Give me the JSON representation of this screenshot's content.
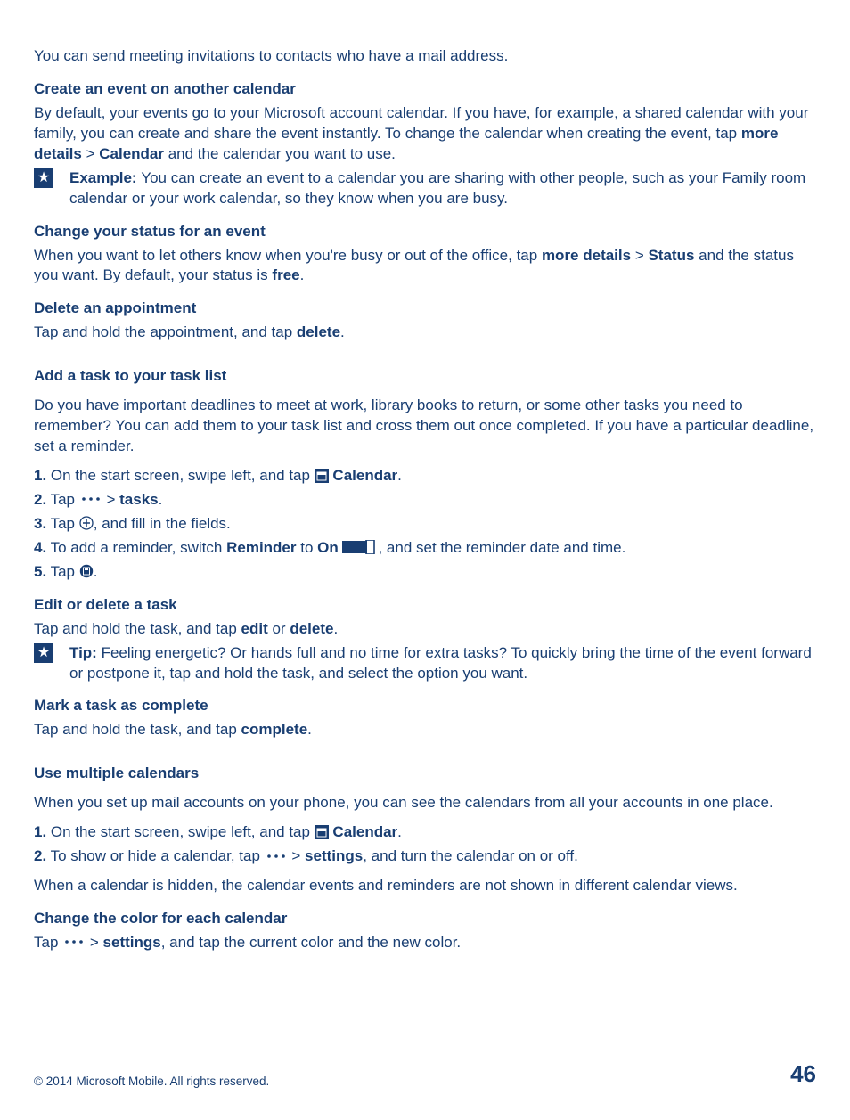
{
  "intro": "You can send meeting invitations to contacts who have a mail address.",
  "sec1": {
    "heading": "Create an event on another calendar",
    "body_a": "By default, your events go to your Microsoft account calendar. If you have, for example, a shared calendar with your family, you can create and share the event instantly. To change the calendar when creating the event, tap ",
    "bold_a": "more details",
    "sep_a": " > ",
    "bold_b": "Calendar",
    "body_b": " and the calendar you want to use.",
    "example_label": "Example: ",
    "example_text": "You can create an event to a calendar you are sharing with other people, such as your Family room calendar or your work calendar, so they know when you are busy."
  },
  "sec2": {
    "heading": "Change your status for an event",
    "body_a": "When you want to let others know when you're busy or out of the office, tap ",
    "bold_a": "more details",
    "sep_a": " > ",
    "bold_b": "Status",
    "body_b": " and the status you want. By default, your status is ",
    "bold_c": "free",
    "body_c": "."
  },
  "sec3": {
    "heading": "Delete an appointment",
    "body_a": "Tap and hold the appointment, and tap ",
    "bold_a": "delete",
    "body_b": "."
  },
  "sec4": {
    "heading": "Add a task to your task list",
    "intro": "Do you have important deadlines to meet at work, library books to return, or some other tasks you need to remember? You can add them to your task list and cross them out once completed. If you have a particular deadline, set a reminder.",
    "step1_a": "1.",
    "step1_b": " On the start screen, swipe left, and tap ",
    "step1_bold": "Calendar",
    "step1_c": ".",
    "step2_a": "2.",
    "step2_b": " Tap ",
    "step2_c": " > ",
    "step2_bold": "tasks",
    "step2_d": ".",
    "step3_a": "3.",
    "step3_b": " Tap ",
    "step3_c": ", and fill in the fields.",
    "step4_a": "4.",
    "step4_b": " To add a reminder, switch ",
    "step4_bold1": "Reminder",
    "step4_c": " to ",
    "step4_bold2": "On",
    "step4_d": ", and set the reminder date and time.",
    "step5_a": "5.",
    "step5_b": " Tap ",
    "step5_c": "."
  },
  "sec5": {
    "heading": "Edit or delete a task",
    "body_a": "Tap and hold the task, and tap ",
    "bold_a": "edit",
    "body_b": " or ",
    "bold_b": "delete",
    "body_c": ".",
    "tip_label": "Tip: ",
    "tip_text": "Feeling energetic? Or hands full and no time for extra tasks? To quickly bring the time of the event forward or postpone it, tap and hold the task, and select the option you want."
  },
  "sec6": {
    "heading": "Mark a task as complete",
    "body_a": "Tap and hold the task, and tap ",
    "bold_a": "complete",
    "body_b": "."
  },
  "sec7": {
    "heading": "Use multiple calendars",
    "intro": "When you set up mail accounts on your phone, you can see the calendars from all your accounts in one place.",
    "step1_a": "1.",
    "step1_b": " On the start screen, swipe left, and tap ",
    "step1_bold": "Calendar",
    "step1_c": ".",
    "step2_a": "2.",
    "step2_b": " To show or hide a calendar, tap ",
    "step2_c": " > ",
    "step2_bold": "settings",
    "step2_d": ", and turn the calendar on or off.",
    "note": "When a calendar is hidden, the calendar events and reminders are not shown in different calendar views."
  },
  "sec8": {
    "heading": "Change the color for each calendar",
    "body_a": "Tap ",
    "body_b": " > ",
    "bold_a": "settings",
    "body_c": ", and tap the current color and the new color."
  },
  "footer": {
    "copyright": "© 2014 Microsoft Mobile. All rights reserved.",
    "page": "46"
  }
}
